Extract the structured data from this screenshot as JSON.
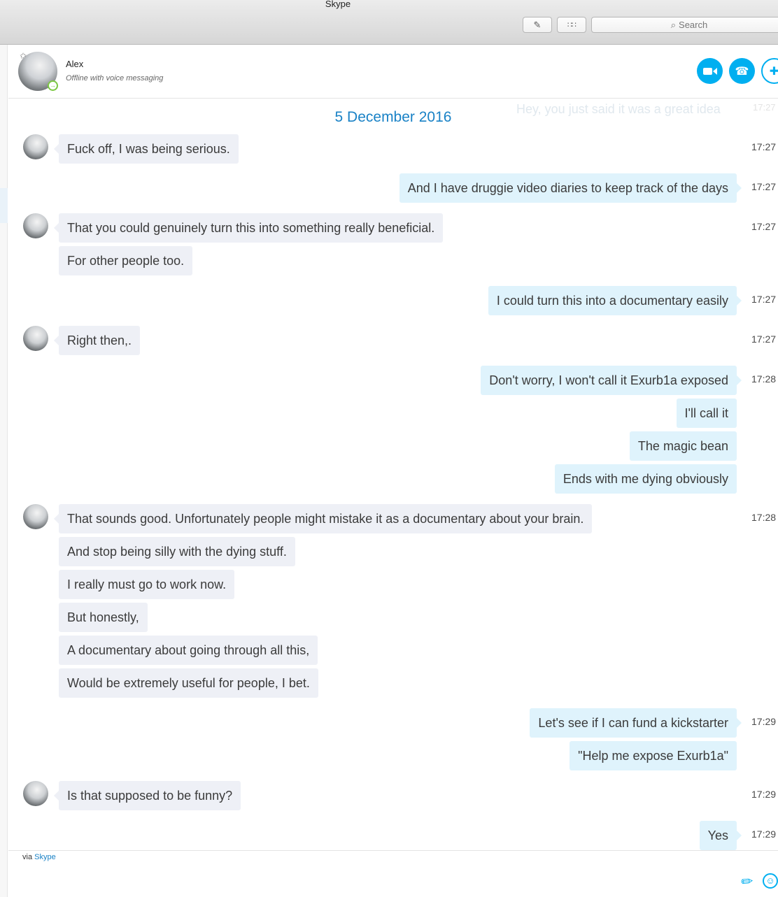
{
  "window": {
    "title": "Skype",
    "search_placeholder": "Search",
    "compose_icon": "compose-icon",
    "dialpad_icon": "dialpad-icon"
  },
  "header": {
    "contact_name": "Alex",
    "contact_status": "Offline with voice messaging"
  },
  "chat": {
    "ghost_message": "Hey, you just said it was a great idea",
    "ghost_time": "17:27",
    "date": "5 December 2016",
    "messages": [
      {
        "text": "Fuck off, I was being serious.",
        "time": "17:27"
      },
      {
        "text": "And I have druggie video diaries to keep track of the days",
        "time": "17:27"
      },
      {
        "text": "That you could genuinely turn this into something really beneficial.",
        "time": "17:27"
      },
      {
        "text": "For other people too."
      },
      {
        "text": "I could turn this into a documentary easily",
        "time": "17:27"
      },
      {
        "text": "Right then,.",
        "time": "17:27"
      },
      {
        "text": "Don't worry, I won't call it Exurb1a exposed",
        "time": "17:28"
      },
      {
        "text": "I'll call it"
      },
      {
        "text": "The magic bean"
      },
      {
        "text": "Ends with me dying obviously"
      },
      {
        "text": "That sounds good. Unfortunately people might mistake it as a documentary about your brain.",
        "time": "17:28"
      },
      {
        "text": "And stop being silly with the dying stuff."
      },
      {
        "text": "I really must go to work now."
      },
      {
        "text": "But honestly,"
      },
      {
        "text": "A documentary about going through all this,"
      },
      {
        "text": "Would be extremely useful for people, I bet."
      },
      {
        "text": "Let's see if I can fund a kickstarter",
        "time": "17:29"
      },
      {
        "text": "\"Help me expose Exurb1a\""
      },
      {
        "text": "Is that supposed to be funny?",
        "time": "17:29"
      },
      {
        "text": "Yes",
        "time": "17:29"
      }
    ]
  },
  "footer": {
    "via_text": "via",
    "via_link": "Skype"
  },
  "colors": {
    "accent": "#00aff0",
    "incoming_bubble": "#eef0f6",
    "outgoing_bubble": "#dff3fc",
    "date_text": "#1a82c6"
  }
}
